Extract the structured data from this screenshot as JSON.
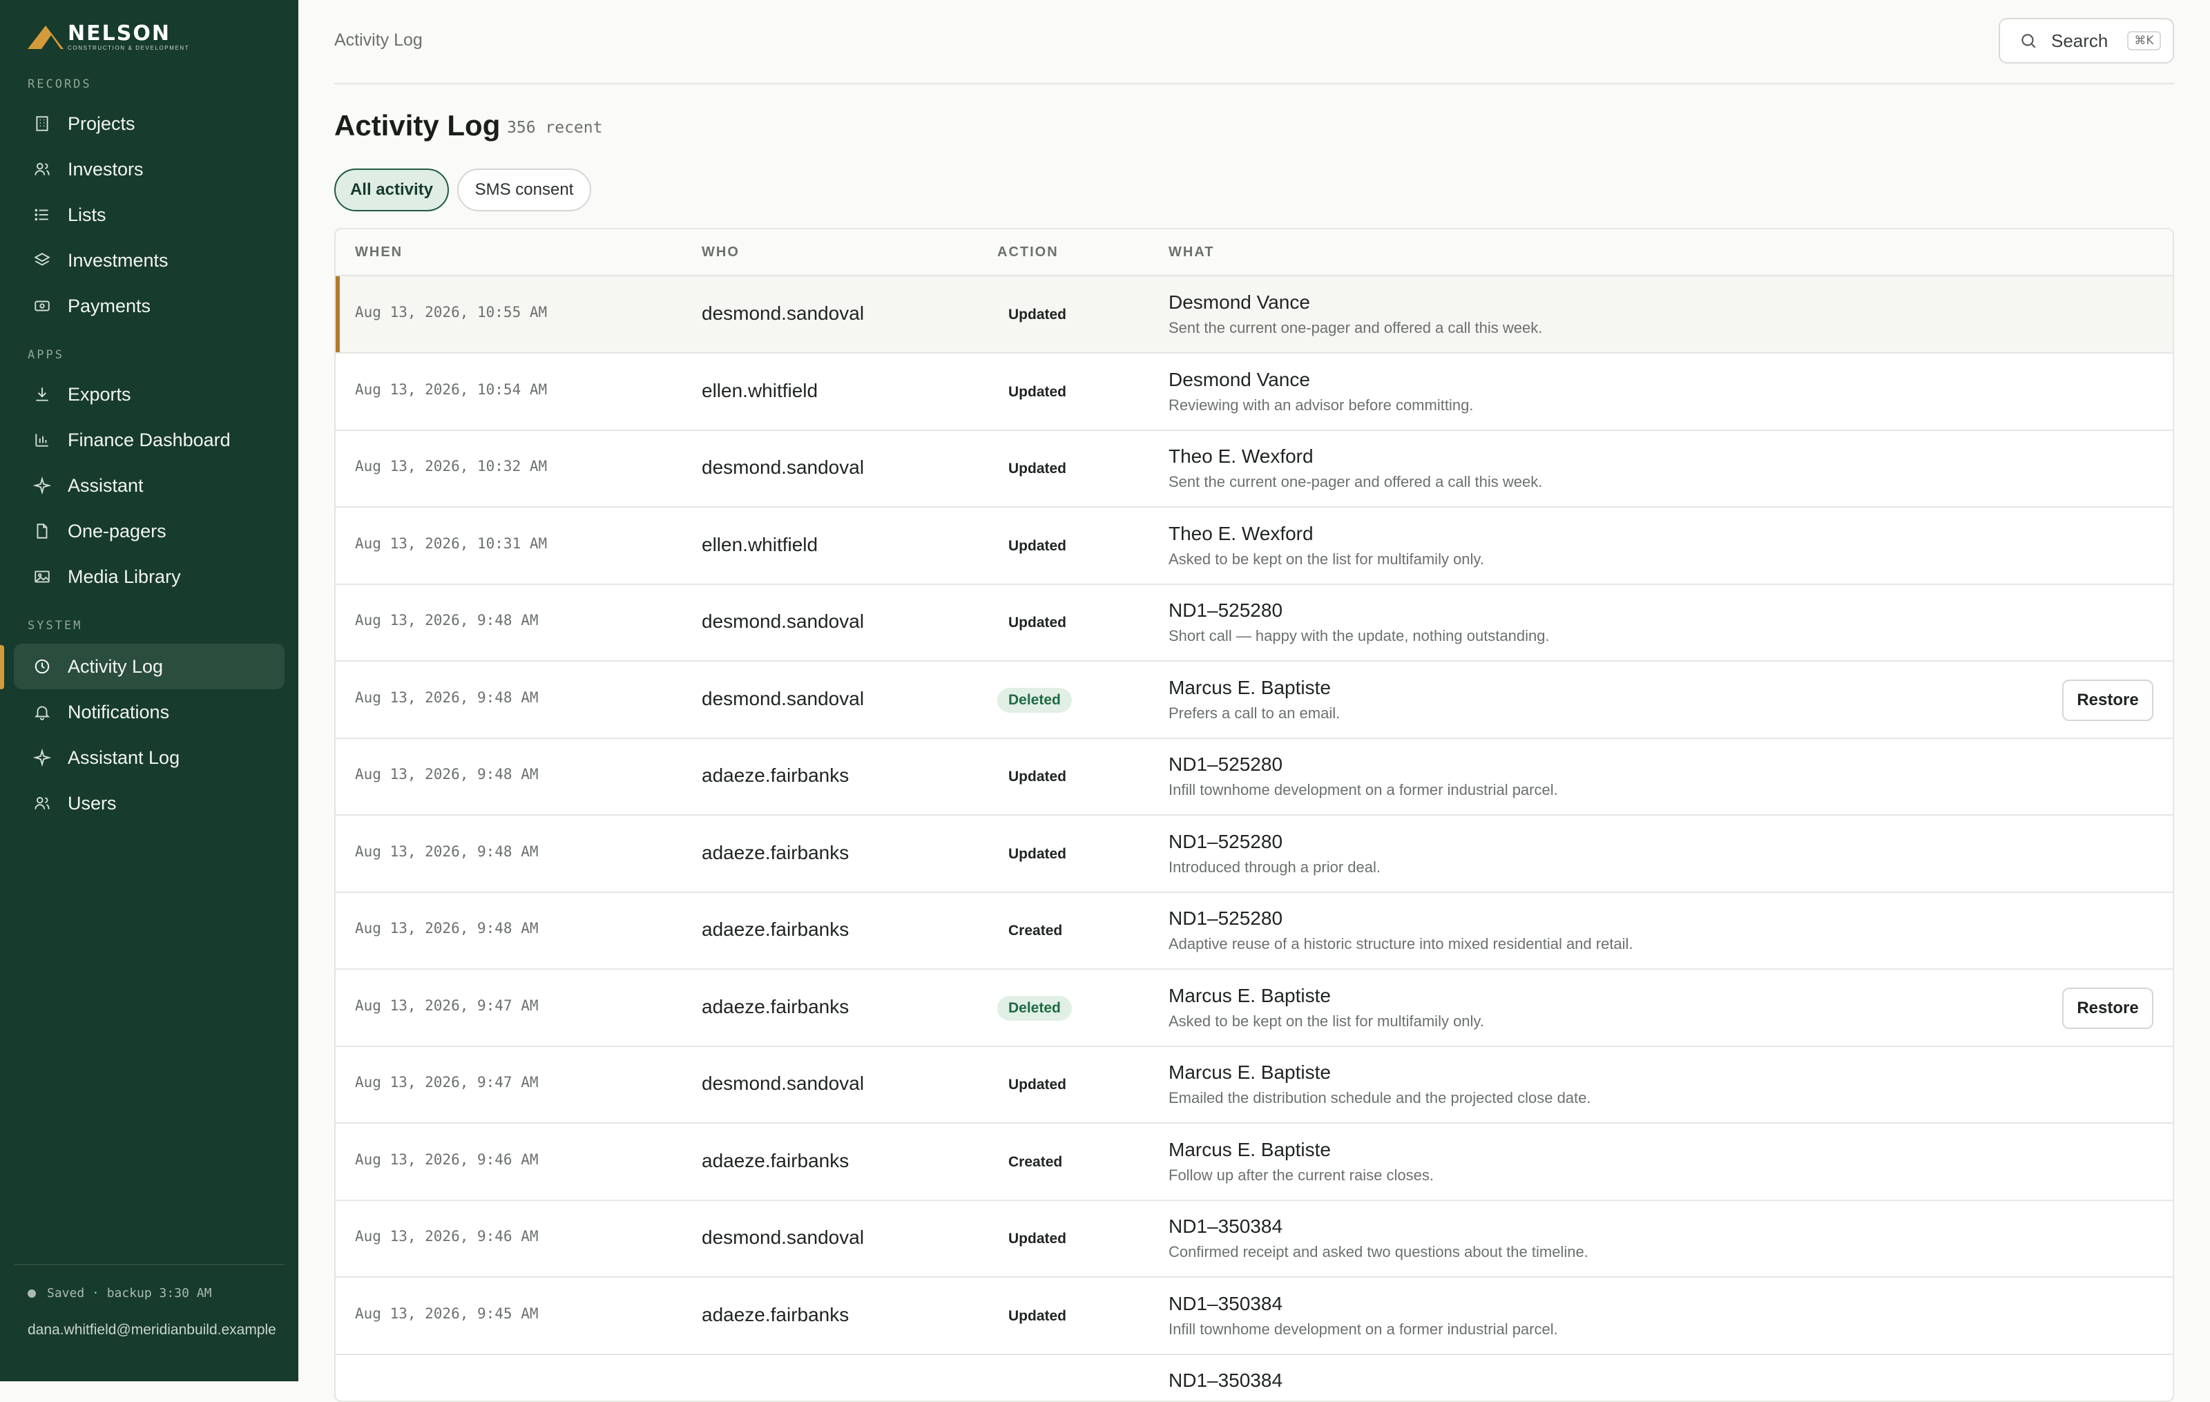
{
  "brand": {
    "name": "NELSON",
    "tagline": "CONSTRUCTION & DEVELOPMENT",
    "accent": "#d49a3c",
    "sidebar_bg": "#173b2c"
  },
  "sidebar": {
    "records_label": "RECORDS",
    "records": [
      {
        "label": "Projects",
        "icon": "building-icon"
      },
      {
        "label": "Investors",
        "icon": "users-icon"
      },
      {
        "label": "Lists",
        "icon": "list-icon"
      },
      {
        "label": "Investments",
        "icon": "layers-icon"
      },
      {
        "label": "Payments",
        "icon": "cash-icon"
      }
    ],
    "apps_label": "APPS",
    "apps": [
      {
        "label": "Exports",
        "icon": "download-icon"
      },
      {
        "label": "Finance Dashboard",
        "icon": "bar-chart-icon"
      },
      {
        "label": "Assistant",
        "icon": "sparkle-icon"
      },
      {
        "label": "One-pagers",
        "icon": "document-icon"
      },
      {
        "label": "Media Library",
        "icon": "image-icon"
      }
    ],
    "system_label": "SYSTEM",
    "system": [
      {
        "label": "Activity Log",
        "icon": "clock-icon",
        "active": true
      },
      {
        "label": "Notifications",
        "icon": "bell-icon"
      },
      {
        "label": "Assistant Log",
        "icon": "sparkle-icon"
      },
      {
        "label": "Users",
        "icon": "users-icon"
      }
    ],
    "saved_status": "Saved · backup 3:30 AM",
    "user_email": "dana.whitfield@meridianbuild.example"
  },
  "header": {
    "breadcrumb": "Activity Log",
    "search_label": "Search",
    "search_shortcut": "⌘K"
  },
  "page": {
    "title": "Activity Log",
    "count": "356 recent"
  },
  "filters": {
    "all": "All activity",
    "sms": "SMS consent"
  },
  "table": {
    "columns": {
      "when": "WHEN",
      "who": "WHO",
      "action": "ACTION",
      "what": "WHAT"
    },
    "restore_label": "Restore",
    "rows": [
      {
        "when": "Aug 13, 2026, 10:55 AM",
        "who": "desmond.sandoval",
        "action": "Updated",
        "title": "Desmond Vance",
        "desc": "Sent the current one-pager and offered a call this week."
      },
      {
        "when": "Aug 13, 2026, 10:54 AM",
        "who": "ellen.whitfield",
        "action": "Updated",
        "title": "Desmond Vance",
        "desc": "Reviewing with an advisor before committing."
      },
      {
        "when": "Aug 13, 2026, 10:32 AM",
        "who": "desmond.sandoval",
        "action": "Updated",
        "title": "Theo E. Wexford",
        "desc": "Sent the current one-pager and offered a call this week."
      },
      {
        "when": "Aug 13, 2026, 10:31 AM",
        "who": "ellen.whitfield",
        "action": "Updated",
        "title": "Theo E. Wexford",
        "desc": "Asked to be kept on the list for multifamily only."
      },
      {
        "when": "Aug 13, 2026, 9:48 AM",
        "who": "desmond.sandoval",
        "action": "Updated",
        "title": "ND1–525280",
        "desc": "Short call — happy with the update, nothing outstanding."
      },
      {
        "when": "Aug 13, 2026, 9:48 AM",
        "who": "desmond.sandoval",
        "action": "Deleted",
        "title": "Marcus E. Baptiste",
        "desc": "Prefers a call to an email."
      },
      {
        "when": "Aug 13, 2026, 9:48 AM",
        "who": "adaeze.fairbanks",
        "action": "Updated",
        "title": "ND1–525280",
        "desc": "Infill townhome development on a former industrial parcel."
      },
      {
        "when": "Aug 13, 2026, 9:48 AM",
        "who": "adaeze.fairbanks",
        "action": "Updated",
        "title": "ND1–525280",
        "desc": "Introduced through a prior deal."
      },
      {
        "when": "Aug 13, 2026, 9:48 AM",
        "who": "adaeze.fairbanks",
        "action": "Created",
        "title": "ND1–525280",
        "desc": "Adaptive reuse of a historic structure into mixed residential and retail."
      },
      {
        "when": "Aug 13, 2026, 9:47 AM",
        "who": "adaeze.fairbanks",
        "action": "Deleted",
        "title": "Marcus E. Baptiste",
        "desc": "Asked to be kept on the list for multifamily only."
      },
      {
        "when": "Aug 13, 2026, 9:47 AM",
        "who": "desmond.sandoval",
        "action": "Updated",
        "title": "Marcus E. Baptiste",
        "desc": "Emailed the distribution schedule and the projected close date."
      },
      {
        "when": "Aug 13, 2026, 9:46 AM",
        "who": "adaeze.fairbanks",
        "action": "Created",
        "title": "Marcus E. Baptiste",
        "desc": "Follow up after the current raise closes."
      },
      {
        "when": "Aug 13, 2026, 9:46 AM",
        "who": "desmond.sandoval",
        "action": "Updated",
        "title": "ND1–350384",
        "desc": "Confirmed receipt and asked two questions about the timeline."
      },
      {
        "when": "Aug 13, 2026, 9:45 AM",
        "who": "adaeze.fairbanks",
        "action": "Updated",
        "title": "ND1–350384",
        "desc": "Infill townhome development on a former industrial parcel."
      },
      {
        "when": "",
        "who": "",
        "action": "",
        "title": "ND1–350384",
        "desc": ""
      }
    ]
  }
}
